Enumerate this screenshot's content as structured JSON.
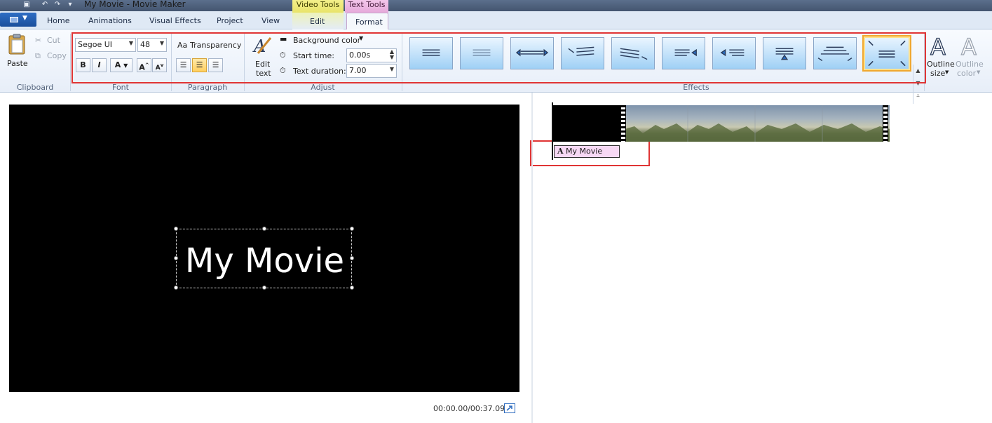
{
  "window": {
    "title": "My Movie - Movie Maker",
    "contextual_tabs": {
      "video_tools": "Video Tools",
      "text_tools": "Text Tools"
    }
  },
  "tabs": [
    {
      "label": "Home"
    },
    {
      "label": "Animations"
    },
    {
      "label": "Visual Effects"
    },
    {
      "label": "Project"
    },
    {
      "label": "View"
    },
    {
      "label": "Edit"
    },
    {
      "label": "Format",
      "selected": true
    }
  ],
  "ribbon": {
    "clipboard": {
      "paste": "Paste",
      "cut": "Cut",
      "copy": "Copy",
      "group_label": "Clipboard"
    },
    "font": {
      "family": "Segoe UI",
      "size": "48",
      "bold": "B",
      "italic": "I",
      "color": "A",
      "grow": "A",
      "shrink": "A",
      "group_label": "Font"
    },
    "paragraph": {
      "transparency": "Transparency",
      "group_label": "Paragraph",
      "alignment_selected": "center"
    },
    "adjust": {
      "edit_text_line1": "Edit",
      "edit_text_line2": "text",
      "background_color": "Background color",
      "start_time_label": "Start time:",
      "start_time_value": "0.00s",
      "text_duration_label": "Text duration:",
      "text_duration_value": "7.00",
      "group_label": "Adjust"
    },
    "effects": {
      "group_label": "Effects",
      "selected_index": 9
    },
    "outline": {
      "size_line1": "Outline",
      "size_line2": "size",
      "color_line1": "Outline",
      "color_line2": "color"
    }
  },
  "preview": {
    "caption": "My Movie",
    "timecode": "00:00.00/00:37.09"
  },
  "storyboard": {
    "caption_clip": "My Movie"
  },
  "colors": {
    "accent_red": "#e03535",
    "ribbon_bg": "#e7eef8",
    "caption_clip_bg": "#f6d8f4"
  }
}
